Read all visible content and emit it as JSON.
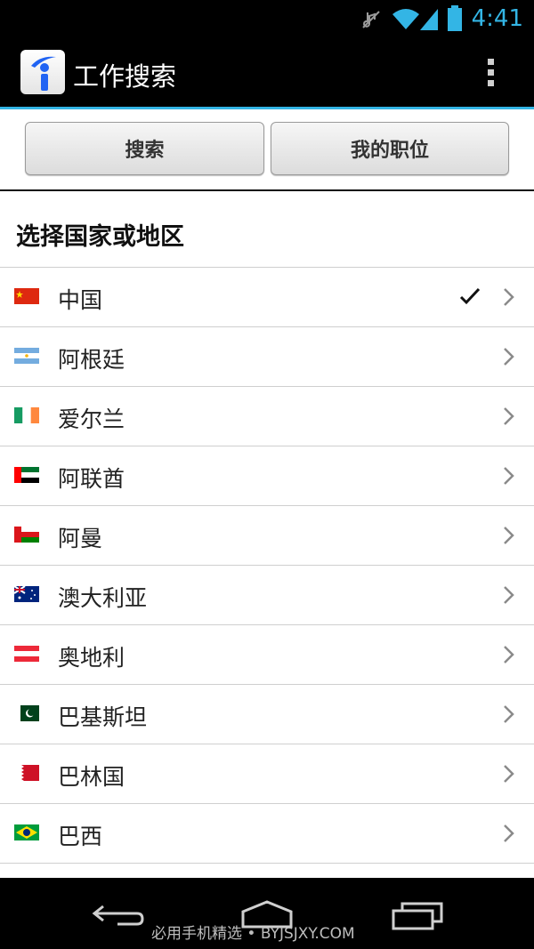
{
  "status_bar": {
    "time": "4:41",
    "icons": [
      "mute-icon",
      "wifi-icon",
      "signal-icon",
      "battery-icon"
    ],
    "accent_color": "#33b5e5"
  },
  "action_bar": {
    "title": "工作搜索",
    "app_icon": "indeed-info-icon",
    "menu_icon": "overflow-menu-icon"
  },
  "tabs": {
    "search_label": "搜索",
    "my_jobs_label": "我的职位"
  },
  "section": {
    "title": "选择国家或地区"
  },
  "countries": [
    {
      "name": "中国",
      "flag": "cn",
      "selected": true
    },
    {
      "name": "阿根廷",
      "flag": "ar",
      "selected": false
    },
    {
      "name": "爱尔兰",
      "flag": "ie",
      "selected": false
    },
    {
      "name": "阿联酋",
      "flag": "ae",
      "selected": false
    },
    {
      "name": "阿曼",
      "flag": "om",
      "selected": false
    },
    {
      "name": "澳大利亚",
      "flag": "au",
      "selected": false
    },
    {
      "name": "奥地利",
      "flag": "at",
      "selected": false
    },
    {
      "name": "巴基斯坦",
      "flag": "pk",
      "selected": false
    },
    {
      "name": "巴林国",
      "flag": "bh",
      "selected": false
    },
    {
      "name": "巴西",
      "flag": "br",
      "selected": false
    }
  ],
  "nav_bar": {
    "icons": [
      "back-icon",
      "home-icon",
      "recents-icon"
    ],
    "watermark": "必用手机精选 • BYJSJXY.COM"
  }
}
